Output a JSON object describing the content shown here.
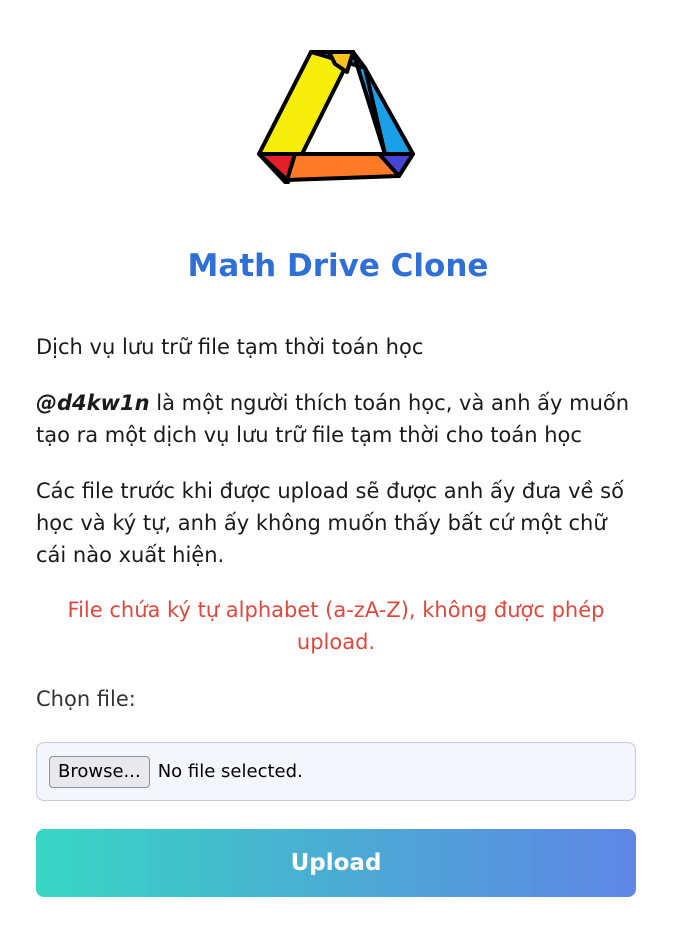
{
  "app": {
    "title": "Math Drive Clone",
    "tagline": "Dịch vụ lưu trữ file tạm thời toán học",
    "author": "@d4kw1n",
    "author_description": " là một người thích toán học, và anh ấy muốn tạo ra một dịch vụ lưu trữ file tạm thời cho toán học",
    "info": "Các file trước khi được upload sẽ được anh ấy đưa về số học và ký tự, anh ấy không muốn thấy bất cứ một chữ cái nào xuất hiện."
  },
  "error_message": "File chứa ký tự alphabet (a-zA-Z), không được phép upload.",
  "form": {
    "file_label": "Chọn file:",
    "browse_label": "Browse...",
    "file_status": "No file selected.",
    "submit_label": "Upload"
  },
  "colors": {
    "title": "#2f6fd8",
    "error": "#e2473b",
    "button_gradient_start": "#38d6c4",
    "button_gradient_end": "#5f86e6"
  },
  "logo": {
    "icon": "drive-triangle-logo-icon"
  }
}
